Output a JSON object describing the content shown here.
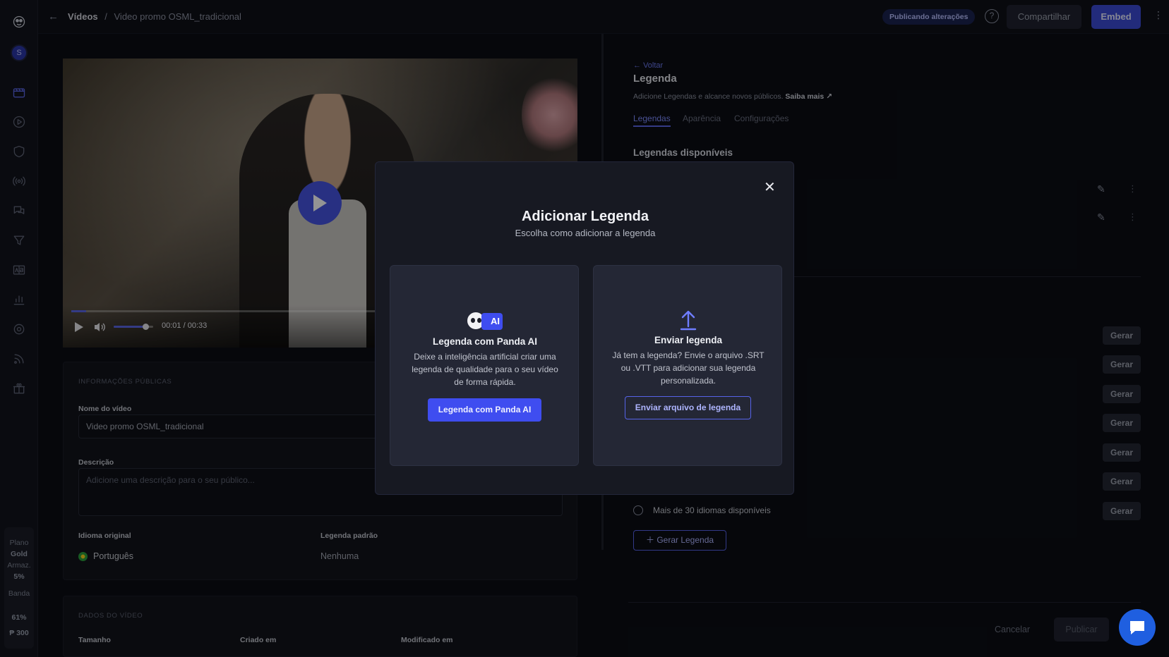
{
  "sidebar": {
    "avatar_initial": "S",
    "plan_label": "Plano",
    "plan_name": "Gold",
    "storage_label": "Armaz.",
    "storage_value": "5%",
    "bandwidth_label": "Banda",
    "bandwidth_value": "61%",
    "credits_value": "300"
  },
  "header": {
    "breadcrumb_root": "Vídeos",
    "breadcrumb_sep": "/",
    "breadcrumb_current": "Video promo OSML_tradicional",
    "status_pill": "Publicando alterações",
    "share_label": "Compartilhar",
    "embed_label": "Embed"
  },
  "player": {
    "time_current": "00:01",
    "time_sep": "/",
    "time_total": "00:33",
    "progress": 0.03,
    "volume": 0.8
  },
  "public_info": {
    "section_title": "INFORMAÇÕES PÚBLICAS",
    "name_label": "Nome do vídeo",
    "name_value": "Video promo OSML_tradicional",
    "desc_label": "Descrição",
    "desc_placeholder": "Adicione uma descrição para o seu público...",
    "orig_lang_label": "Idioma original",
    "orig_lang_value": "Português",
    "default_caption_label": "Legenda padrão",
    "default_caption_value": "Nenhuma"
  },
  "video_data": {
    "section_title": "DADOS DO VÍDEO",
    "size_label": "Tamanho",
    "created_label": "Criado em",
    "modified_label": "Modificado em"
  },
  "captions_panel": {
    "back_label": "Voltar",
    "title": "Legenda",
    "subtitle": "Adicione Legendas e alcance novos públicos.",
    "learn_more": "Saiba mais",
    "tabs": [
      "Legendas",
      "Aparência",
      "Configurações"
    ],
    "available_title": "Legendas disponíveis",
    "gerar_labels": [
      "Gerar",
      "Gerar",
      "Gerar",
      "Gerar",
      "Gerar",
      "Gerar",
      "Gerar"
    ],
    "more_languages": "Mais de 30 idiomas disponíveis",
    "generate_button": "Gerar Legenda",
    "cancel_label": "Cancelar",
    "publish_label": "Publicar"
  },
  "modal": {
    "title": "Adicionar Legenda",
    "subtitle": "Escolha como adicionar a legenda",
    "ai_card": {
      "badge": "AI",
      "title": "Legenda com Panda AI",
      "desc_lines": [
        "Deixe a inteligência artificial criar uma",
        "legenda de qualidade para o seu vídeo",
        "de forma rápida."
      ],
      "button": "Legenda com Panda AI"
    },
    "upload_card": {
      "title": "Enviar legenda",
      "desc_lines": [
        "Já tem a legenda? Envie o arquivo .SRT",
        "ou .VTT para adicionar sua legenda",
        "personalizada."
      ],
      "button": "Enviar arquivo de legenda"
    }
  },
  "colors": {
    "accent": "#3f4df0",
    "background": "#0b0d14",
    "modal": "#171922",
    "card": "#242735"
  }
}
